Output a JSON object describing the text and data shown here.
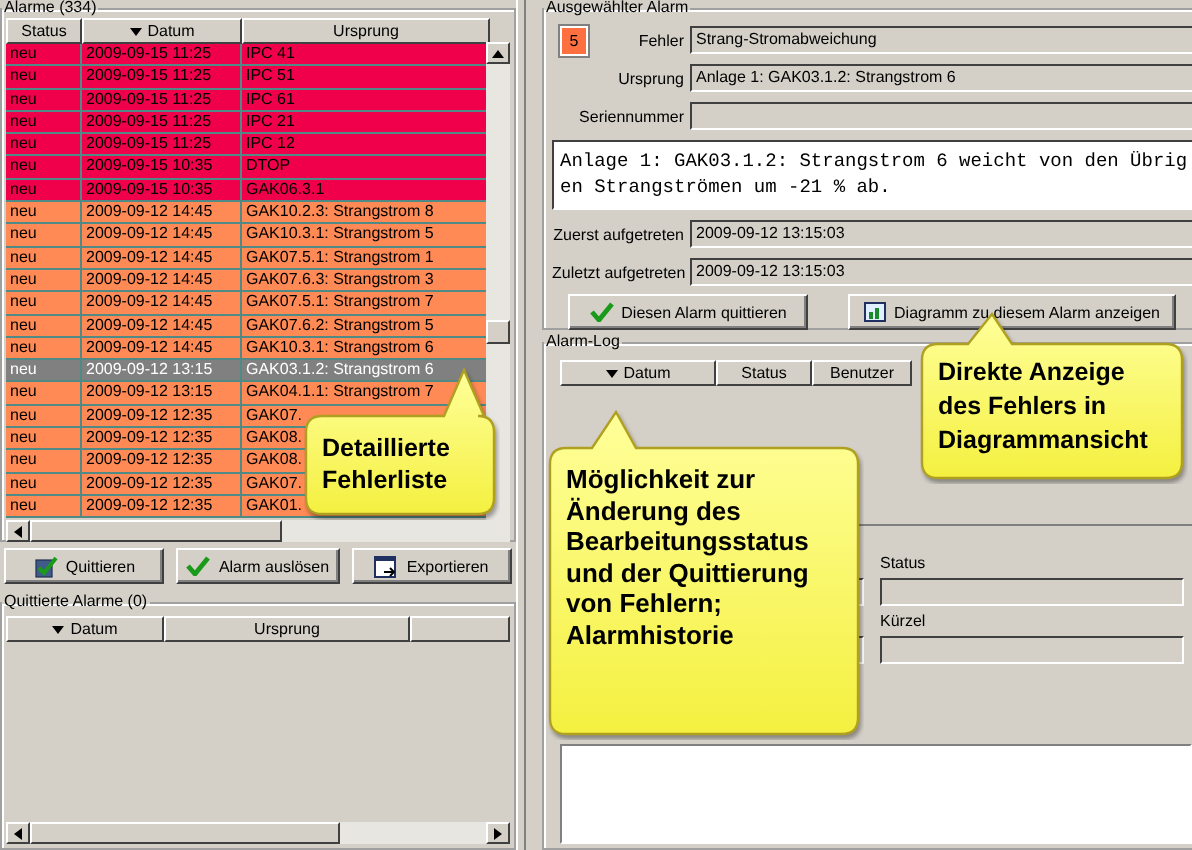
{
  "alarms": {
    "title": "Alarme (334)",
    "columns": [
      {
        "label": "Status",
        "sorted": false
      },
      {
        "label": "Datum",
        "sorted": true
      },
      {
        "label": "Ursprung",
        "sorted": false
      }
    ],
    "rows": [
      {
        "status": "neu",
        "datum": "2009-09-15 11:25",
        "ursprung": "IPC 41",
        "color": "#f0004a",
        "selected": false
      },
      {
        "status": "neu",
        "datum": "2009-09-15 11:25",
        "ursprung": "IPC 51",
        "color": "#f0004a",
        "selected": false
      },
      {
        "status": "neu",
        "datum": "2009-09-15 11:25",
        "ursprung": "IPC 61",
        "color": "#f0004a",
        "selected": false
      },
      {
        "status": "neu",
        "datum": "2009-09-15 11:25",
        "ursprung": "IPC 21",
        "color": "#f0004a",
        "selected": false
      },
      {
        "status": "neu",
        "datum": "2009-09-15 11:25",
        "ursprung": "IPC 12",
        "color": "#f0004a",
        "selected": false
      },
      {
        "status": "neu",
        "datum": "2009-09-15 10:35",
        "ursprung": "DTOP",
        "color": "#f0004a",
        "selected": false
      },
      {
        "status": "neu",
        "datum": "2009-09-15 10:35",
        "ursprung": "GAK06.3.1",
        "color": "#f0004a",
        "selected": false
      },
      {
        "status": "neu",
        "datum": "2009-09-12 14:45",
        "ursprung": "GAK10.2.3: Strangstrom 8",
        "color": "#ff8a55",
        "selected": false
      },
      {
        "status": "neu",
        "datum": "2009-09-12 14:45",
        "ursprung": "GAK10.3.1: Strangstrom 5",
        "color": "#ff8a55",
        "selected": false
      },
      {
        "status": "neu",
        "datum": "2009-09-12 14:45",
        "ursprung": "GAK07.5.1: Strangstrom 1",
        "color": "#ff8a55",
        "selected": false
      },
      {
        "status": "neu",
        "datum": "2009-09-12 14:45",
        "ursprung": "GAK07.6.3: Strangstrom 3",
        "color": "#ff8a55",
        "selected": false
      },
      {
        "status": "neu",
        "datum": "2009-09-12 14:45",
        "ursprung": "GAK07.5.1: Strangstrom 7",
        "color": "#ff8a55",
        "selected": false
      },
      {
        "status": "neu",
        "datum": "2009-09-12 14:45",
        "ursprung": "GAK07.6.2: Strangstrom 5",
        "color": "#ff8a55",
        "selected": false
      },
      {
        "status": "neu",
        "datum": "2009-09-12 14:45",
        "ursprung": "GAK10.3.1: Strangstrom 6",
        "color": "#ff8a55",
        "selected": false
      },
      {
        "status": "neu",
        "datum": "2009-09-12 13:15",
        "ursprung": "GAK03.1.2: Strangstrom 6",
        "selected": true
      },
      {
        "status": "neu",
        "datum": "2009-09-12 13:15",
        "ursprung": "GAK04.1.1: Strangstrom 7",
        "color": "#ff8a55",
        "selected": false
      },
      {
        "status": "neu",
        "datum": "2009-09-12 12:35",
        "ursprung": "GAK07.",
        "color": "#ff8a55",
        "selected": false
      },
      {
        "status": "neu",
        "datum": "2009-09-12 12:35",
        "ursprung": "GAK08.",
        "color": "#ff8a55",
        "selected": false
      },
      {
        "status": "neu",
        "datum": "2009-09-12 12:35",
        "ursprung": "GAK08.",
        "color": "#ff8a55",
        "selected": false
      },
      {
        "status": "neu",
        "datum": "2009-09-12 12:35",
        "ursprung": "GAK07.",
        "color": "#ff8a55",
        "selected": false
      },
      {
        "status": "neu",
        "datum": "2009-09-12 12:35",
        "ursprung": "GAK01.",
        "color": "#ff8a55",
        "selected": false
      }
    ]
  },
  "alarm_buttons": [
    {
      "label": "Quittieren",
      "kind": "acknowledge"
    },
    {
      "label": "Alarm auslösen",
      "kind": "check"
    },
    {
      "label": "Exportieren",
      "kind": "export"
    }
  ],
  "acknowledged": {
    "title": "Quittierte Alarme (0)",
    "columns": [
      {
        "label": "Datum",
        "sorted": true
      },
      {
        "label": "Ursprung",
        "sorted": false
      }
    ]
  },
  "selected_alarm": {
    "title": "Ausgewählter Alarm",
    "severity": "5",
    "fields": [
      {
        "label": "Fehler",
        "value": "Strang-Stromabweichung"
      },
      {
        "label": "Ursprung",
        "value": "Anlage 1: GAK03.1.2: Strangstrom 6"
      },
      {
        "label": "Seriennummer"
      }
    ],
    "message": "Anlage 1: GAK03.1.2: Strangstrom 6 weicht von den Übrig\nen Strangströmen um -21 % ab.",
    "times": [
      {
        "label": "Zuerst aufgetreten",
        "value": "2009-09-12 13:15:03"
      },
      {
        "label": "Zuletzt aufgetreten",
        "value": "2009-09-12 13:15:03"
      }
    ],
    "buttons": [
      {
        "label": "Diesen Alarm quittieren",
        "kind": "check"
      },
      {
        "label": "Diagramm zu diesem Alarm anzeigen",
        "kind": "chart"
      }
    ]
  },
  "alarm_log": {
    "title": "Alarm-Log",
    "columns": [
      {
        "label": "Datum",
        "sorted": true
      },
      {
        "label": "Status",
        "sorted": false
      },
      {
        "label": "Benutzer",
        "sorted": false
      }
    ],
    "fields": [
      {
        "label": "Status"
      },
      {
        "label": "Kürzel"
      }
    ]
  },
  "callouts": [
    {
      "text": "Detaillierte\nFehlerliste"
    },
    {
      "text": "Direkte Anzeige\ndes Fehlers in\nDiagrammansicht"
    },
    {
      "text": "Möglichkeit zur\nÄnderung des\nBearbeitungsstatus\nund der Quittierung\nvon Fehlern;\nAlarmhistorie"
    }
  ]
}
